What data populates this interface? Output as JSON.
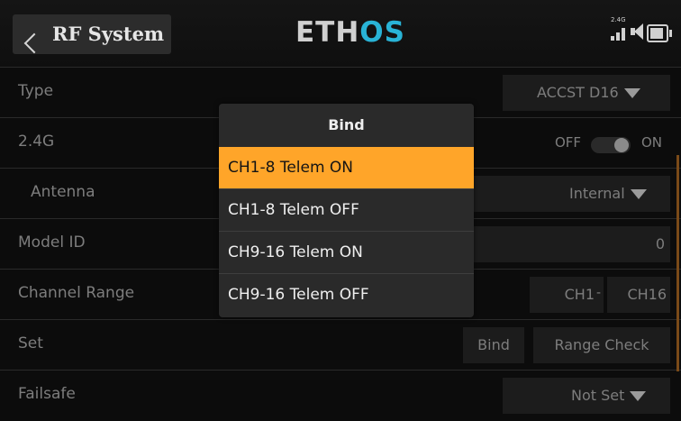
{
  "header": {
    "title": "RF System",
    "logo_main": "ETH",
    "logo_accent": "OS",
    "band_label": "2.4G"
  },
  "rows": {
    "type": {
      "label": "Type",
      "value": "ACCST D16"
    },
    "band": {
      "label": "2.4G",
      "off_label": "OFF",
      "on_label": "ON"
    },
    "antenna": {
      "label": "Antenna",
      "value": "Internal"
    },
    "model_id": {
      "label": "Model ID",
      "value": "0"
    },
    "channel_range": {
      "label": "Channel Range",
      "start": "CH1",
      "separator": "-",
      "end": "CH16"
    },
    "set": {
      "label": "Set",
      "bind_label": "Bind",
      "range_check_label": "Range Check"
    },
    "failsafe": {
      "label": "Failsafe",
      "value": "Not Set"
    }
  },
  "dialog": {
    "title": "Bind",
    "options": [
      "CH1-8 Telem ON",
      "CH1-8 Telem OFF",
      "CH9-16 Telem ON",
      "CH9-16 Telem OFF"
    ],
    "selected_index": 0
  },
  "colors": {
    "accent": "#ffa529",
    "logo_accent": "#29b3d6",
    "background": "#0c0c0c"
  },
  "icons": {
    "back": "chevron-left-icon",
    "signal": "signal-bars-icon",
    "sound": "speaker-icon",
    "battery": "battery-icon",
    "dropdown": "triangle-down-icon"
  }
}
